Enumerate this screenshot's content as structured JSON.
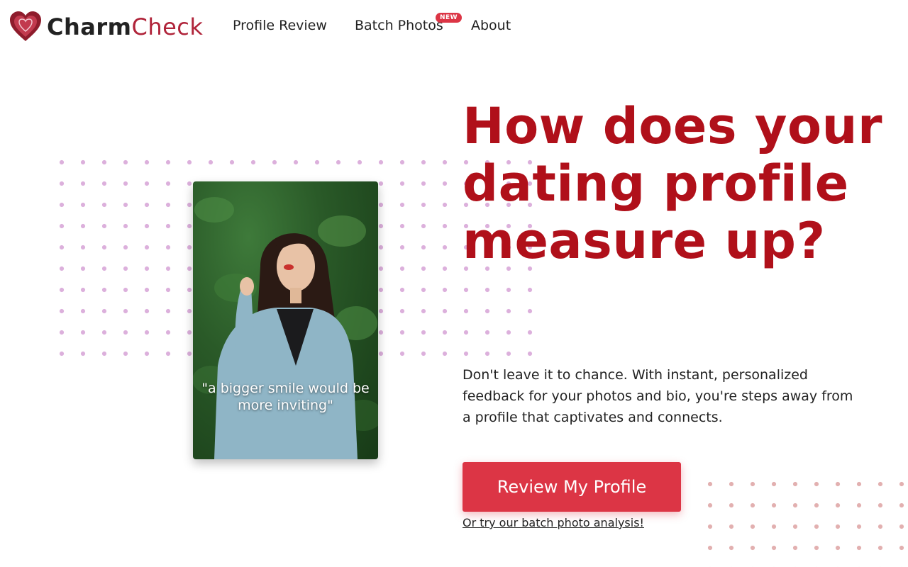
{
  "brand": {
    "name_bold": "Charm",
    "name_light": "Check",
    "accent": "#b0243a",
    "icon": "heart-icon"
  },
  "nav": {
    "items": [
      {
        "label": "Profile Review"
      },
      {
        "label": "Batch Photos",
        "badge": "NEW"
      },
      {
        "label": "About"
      }
    ]
  },
  "hero": {
    "photo_quote": "\"a bigger smile would be more inviting\"",
    "headline": "How does your dating profile measure up?",
    "subtext": "Don't leave it to chance. With instant, personalized feedback for your photos and bio, you're steps away from a profile that captivates and connects.",
    "cta_label": "Review My Profile",
    "alt_link": "Or try our batch photo analysis!"
  },
  "colors": {
    "headline": "#b0101a",
    "cta": "#dc3545",
    "dots_purple": "#dcb0dc",
    "dots_pink": "#e2b0b0"
  }
}
